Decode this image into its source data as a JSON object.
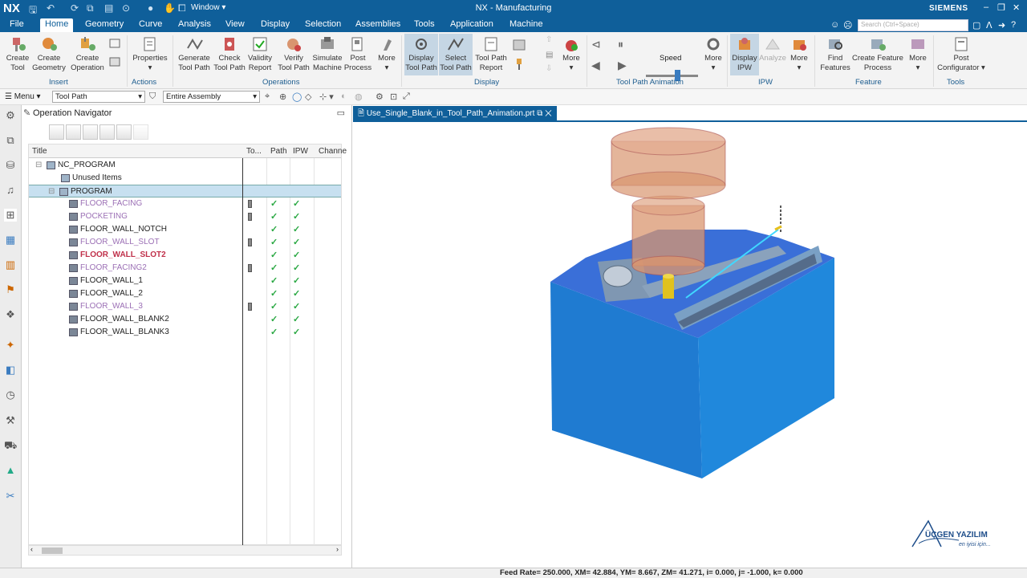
{
  "window": {
    "app_logo": "NX",
    "title": "NX - Manufacturing",
    "window_menu": "Window",
    "brand": "SIEMENS"
  },
  "menu": {
    "tabs": [
      "File",
      "Home",
      "Geometry",
      "Curve",
      "Analysis",
      "View",
      "Display",
      "Selection",
      "Assemblies",
      "Tools",
      "Application",
      "Machine"
    ],
    "active_tab": "Home",
    "search_placeholder": "Search (Ctrl+Space)"
  },
  "ribbon": {
    "buttons": [
      {
        "label1": "Create",
        "label2": "Tool"
      },
      {
        "label1": "Create",
        "label2": "Geometry"
      },
      {
        "label1": "Create",
        "label2": "Operation"
      },
      {
        "label1": "Properties",
        "label2": ""
      },
      {
        "label1": "Generate",
        "label2": "Tool Path"
      },
      {
        "label1": "Check",
        "label2": "Tool Path"
      },
      {
        "label1": "Validity",
        "label2": "Report"
      },
      {
        "label1": "Verify",
        "label2": "Tool Path"
      },
      {
        "label1": "Simulate",
        "label2": "Machine"
      },
      {
        "label1": "Post",
        "label2": "Process"
      },
      {
        "label1": "More",
        "label2": ""
      },
      {
        "label1": "Display",
        "label2": "Tool Path"
      },
      {
        "label1": "Select",
        "label2": "Tool Path"
      },
      {
        "label1": "Tool Path",
        "label2": "Report"
      },
      {
        "label1": "More",
        "label2": ""
      },
      {
        "label1": "More",
        "label2": ""
      },
      {
        "label1": "Display",
        "label2": "IPW"
      },
      {
        "label1": "Analyze",
        "label2": ""
      },
      {
        "label1": "More",
        "label2": ""
      },
      {
        "label1": "Find",
        "label2": "Features"
      },
      {
        "label1": "Create Feature",
        "label2": "Process"
      },
      {
        "label1": "More",
        "label2": ""
      },
      {
        "label1": "Post",
        "label2": "Configurator"
      }
    ],
    "speed_label": "Speed",
    "speed_level_percent": 60,
    "groups": [
      "Insert",
      "Actions",
      "Operations",
      "Display",
      "Tool Path Animation",
      "IPW",
      "Feature",
      "Tools"
    ]
  },
  "toolbar2": {
    "menu_label": "Menu",
    "filter_value": "Tool Path",
    "scope_value": "Entire Assembly"
  },
  "navigator": {
    "title": "Operation Navigator",
    "columns": [
      "Title",
      "To...",
      "Path",
      "IPW",
      "Channe"
    ],
    "rows": [
      {
        "name": "NC_PROGRAM",
        "style": "normal",
        "toolbox": false,
        "path": false,
        "ipw": false
      },
      {
        "name": "Unused Items",
        "style": "normal",
        "toolbox": false,
        "path": false,
        "ipw": false
      },
      {
        "name": "PROGRAM",
        "style": "normal",
        "toolbox": false,
        "path": false,
        "ipw": false
      },
      {
        "name": "FLOOR_FACING",
        "style": "purple",
        "toolbox": true,
        "path": true,
        "ipw": true
      },
      {
        "name": "POCKETING",
        "style": "purple",
        "toolbox": true,
        "path": true,
        "ipw": true
      },
      {
        "name": "FLOOR_WALL_NOTCH",
        "style": "normal",
        "toolbox": false,
        "path": true,
        "ipw": true
      },
      {
        "name": "FLOOR_WALL_SLOT",
        "style": "purple",
        "toolbox": true,
        "path": true,
        "ipw": true
      },
      {
        "name": "FLOOR_WALL_SLOT2",
        "style": "red-bold",
        "toolbox": false,
        "path": true,
        "ipw": true
      },
      {
        "name": "FLOOR_FACING2",
        "style": "purple",
        "toolbox": true,
        "path": true,
        "ipw": true
      },
      {
        "name": "FLOOR_WALL_1",
        "style": "normal",
        "toolbox": false,
        "path": true,
        "ipw": true
      },
      {
        "name": "FLOOR_WALL_2",
        "style": "normal",
        "toolbox": false,
        "path": true,
        "ipw": true
      },
      {
        "name": "FLOOR_WALL_3",
        "style": "purple",
        "toolbox": true,
        "path": true,
        "ipw": true
      },
      {
        "name": "FLOOR_WALL_BLANK2",
        "style": "normal",
        "toolbox": false,
        "path": true,
        "ipw": true
      },
      {
        "name": "FLOOR_WALL_BLANK3",
        "style": "normal",
        "toolbox": false,
        "path": true,
        "ipw": true
      }
    ],
    "check_glyph": "✓"
  },
  "viewport": {
    "tab_label": "Use_Single_Blank_in_Tool_Path_Animation.prt",
    "watermark_name": "ÜÇGEN YAZILIM",
    "watermark_sub": "en iyisi için..."
  },
  "status": {
    "text": "Feed Rate= 250.000, XM= 42.884, YM= 8.667, ZM= 41.271, i= 0.000, j= -1.000, k= 0.000"
  },
  "colors": {
    "titlebar": "#0f5f9a",
    "part_blue": "#1f7bd1",
    "tool_body": "#d9956f",
    "tool_bit": "#e0c21e",
    "purple_op": "#9b6fb5",
    "red_op": "#c0304a",
    "check": "#2aa843"
  }
}
